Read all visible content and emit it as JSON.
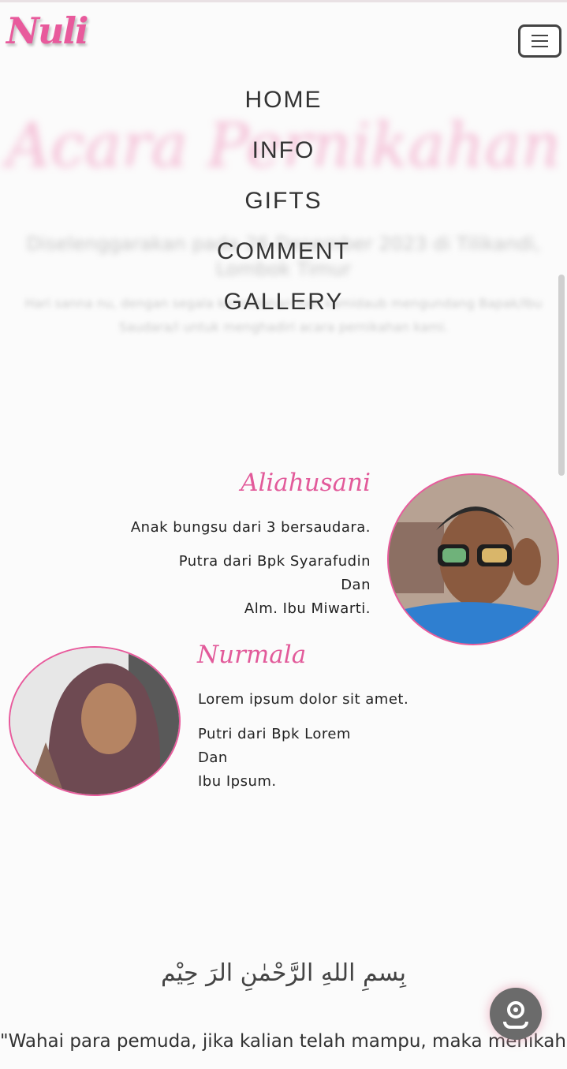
{
  "header": {
    "logo": "Nuli",
    "menu_icon": "hamburger-icon"
  },
  "hero": {
    "title": "Acara Pernikahan",
    "subtitle": "Diselenggarakan pada 26 Desember 2023 di Tilikandi, Lombok Timur",
    "description": "Hari sanna nu, dengan segala kerendahan hati kamidaub mengundang Bapak/Ibu Saudara/i untuk menghadiri acara pernikahan kami."
  },
  "nav": {
    "items": [
      "HOME",
      "INFO",
      "GIFTS",
      "COMMENT",
      "GALLERY"
    ]
  },
  "groom": {
    "name": "Aliahusani",
    "line1": "Anak bungsu dari 3 bersaudara.",
    "parent1": "Putra dari Bpk Syarafudin",
    "conj": "Dan",
    "parent2": "Alm. Ibu Miwarti."
  },
  "bride": {
    "name": "Nurmala",
    "line1": "Lorem ipsum dolor sit amet.",
    "parent1": "Putri dari Bpk Lorem",
    "conj": "Dan",
    "parent2": "Ibu Ipsum."
  },
  "verse": {
    "basmalah": "بِسمِ اللهِ الرَّحْمٰنِ الرَ حِيْم",
    "quote": "\"Wahai para pemuda, jika kalian telah mampu, maka menikahlah. Sungguh menikah itu lebih menentramkan"
  },
  "music_button_icon": "music-disc-icon",
  "colors": {
    "accent": "#e85a9c",
    "text": "#222222"
  }
}
